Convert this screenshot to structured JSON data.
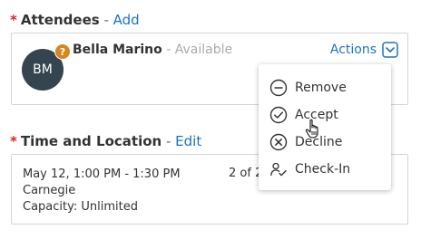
{
  "attendees": {
    "required_mark": "*",
    "title": "Attendees",
    "separator": " - ",
    "add_label": "Add",
    "attendee": {
      "initials": "BM",
      "status_badge": "?",
      "name": "Bella Marino",
      "status": " - Available"
    },
    "actions_label": "Actions",
    "actions_icon": "chevron-down-icon"
  },
  "actions_menu": {
    "items": [
      {
        "label": "Remove",
        "icon": "minus-circle-icon"
      },
      {
        "label": "Accept",
        "icon": "check-circle-icon"
      },
      {
        "label": "Decline",
        "icon": "x-circle-icon"
      },
      {
        "label": "Check-In",
        "icon": "check-in-icon"
      }
    ]
  },
  "time_location": {
    "required_mark": "*",
    "title": "Time and Location",
    "separator": " - ",
    "edit_label": "Edit",
    "date_time": "May 12, 1:00 PM - 1:30 PM",
    "location": "Carnegie",
    "capacity": "Capacity: Unlimited",
    "count": "2 of 2"
  },
  "colors": {
    "link": "#1a73c8",
    "required": "#e0251b",
    "avatar_bg": "#35454f",
    "badge_bg": "#d4871f"
  }
}
